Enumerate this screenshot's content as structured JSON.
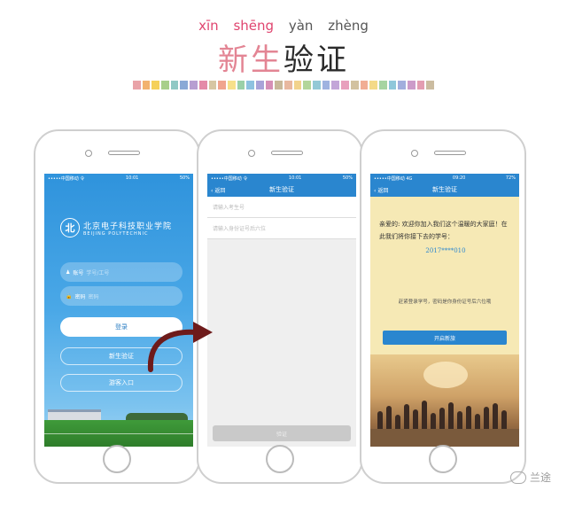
{
  "header": {
    "pinyin": [
      "xīn",
      "shēng",
      "yàn",
      "zhèng"
    ],
    "title_part1": "新生",
    "title_part2": "验证",
    "swatches": [
      "#e9a3a8",
      "#f2b26f",
      "#f5d15a",
      "#a8cf8a",
      "#8fc8c4",
      "#8aa9d6",
      "#b79ed1",
      "#e48aa8",
      "#d7c6a3",
      "#f0a48e",
      "#f6e08a",
      "#9ad0a8",
      "#8ec2e0",
      "#a9a3d8",
      "#d68fb6",
      "#c8b89a",
      "#e8b8a0",
      "#f2d38c",
      "#b3d69a",
      "#93c9d6",
      "#9fb3e0",
      "#c3a6d8",
      "#e8a0bd",
      "#d2c2a0",
      "#f1ad94",
      "#f4da88",
      "#a6d4a2",
      "#8fc7da",
      "#a2aedd",
      "#cc9bc9",
      "#e39db1",
      "#cbbca0"
    ]
  },
  "phone1": {
    "status_left": "•••••中国移动 令",
    "status_time": "10:01",
    "status_right": "50%",
    "logo_cn": "北京电子科技职业学院",
    "logo_en": "BEIJING POLYTECHNIC",
    "account_label": "账号",
    "account_placeholder": "学号/工号",
    "password_label": "密码",
    "password_placeholder": "密码",
    "login_button": "登录",
    "verify_button": "新生验证",
    "guest_button": "游客入口"
  },
  "phone2": {
    "status_left": "•••••中国移动 令",
    "status_time": "10:01",
    "status_right": "50%",
    "back_label": "返回",
    "nav_title": "新生验证",
    "exam_placeholder": "请输入考生号",
    "id_placeholder": "请输入身份证号后六位",
    "verify_button": "验证"
  },
  "phone3": {
    "status_left": "•••••中国移动 4G",
    "status_time": "09:20",
    "status_right": "72%",
    "back_label": "返回",
    "nav_title": "新生验证",
    "greeting": "亲爱的:",
    "body": "欢迎你加入我们这个温暖的大家庭！在此我们将你接下去的学号：",
    "student_no": "2017****010",
    "note": "赶紧登录学号，密码是你身份证号后六位哦",
    "start_button": "开启新旅"
  },
  "watermark": {
    "text": "兰途"
  }
}
